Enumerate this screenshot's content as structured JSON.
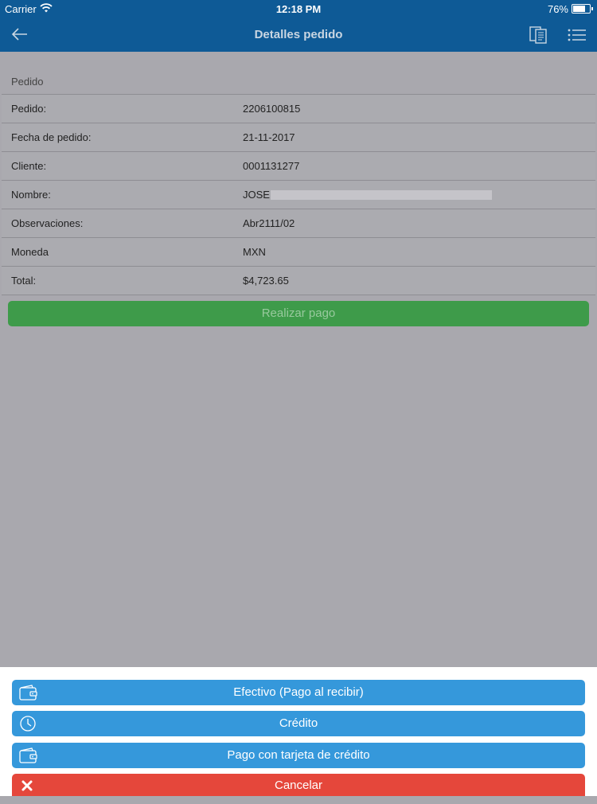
{
  "status_bar": {
    "carrier": "Carrier",
    "time": "12:18 PM",
    "battery": "76%",
    "battery_level": 0.76
  },
  "nav": {
    "title": "Detalles pedido",
    "back_icon": "arrow-left-icon",
    "doc_icon": "documents-icon",
    "menu_icon": "list-menu-icon"
  },
  "section": {
    "title": "Pedido"
  },
  "details": [
    {
      "label": "Pedido:",
      "value": "2206100815"
    },
    {
      "label": "Fecha de pedido:",
      "value": "21-11-2017"
    },
    {
      "label": "Cliente:",
      "value": "0001131277"
    },
    {
      "label": "Nombre:",
      "value": "JOSE"
    },
    {
      "label": "Observaciones:",
      "value": "Abr2111/02"
    },
    {
      "label": "Moneda",
      "value": "MXN"
    },
    {
      "label": "Total:",
      "value": "$4,723.65"
    }
  ],
  "pay_button": {
    "label": "Realizar pago"
  },
  "action_sheet": {
    "cash_label": "Efectivo (Pago al recibir)",
    "credit_label": "Crédito",
    "card_label": "Pago con tarjeta de crédito",
    "cancel_label": "Cancelar"
  },
  "colors": {
    "nav": "#0e5a96",
    "overlay": "#a9a8ae",
    "pay_green": "#3e9b4a",
    "sheet_blue": "#3598db",
    "cancel_red": "#e5473b"
  }
}
